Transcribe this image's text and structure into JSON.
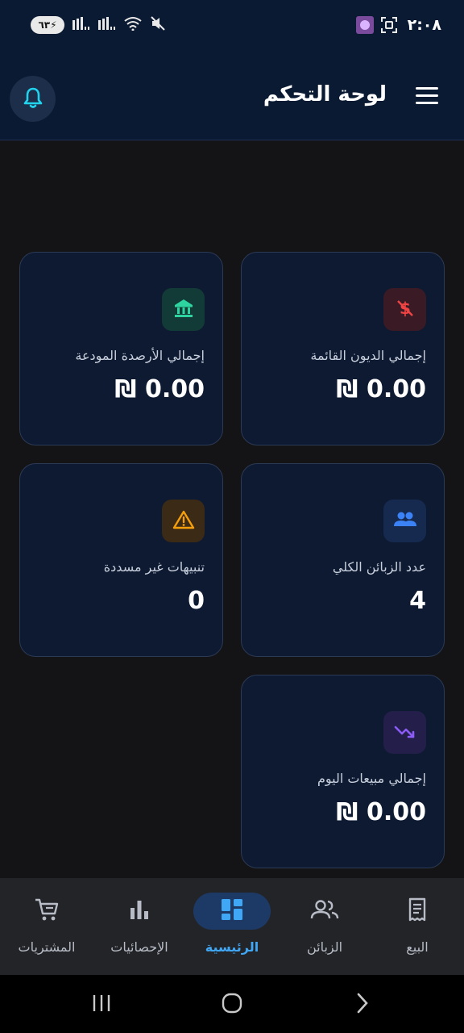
{
  "status_bar": {
    "time": "٢:٠٨",
    "battery": "٦٣"
  },
  "header": {
    "title": "لوحة التحكم"
  },
  "cards": [
    {
      "label": "إجمالي الديون القائمة",
      "value": "0.00 ₪",
      "icon": "dollar-off-icon",
      "color": "#ef4444"
    },
    {
      "label": "إجمالي الأرصدة المودعة",
      "value": "0.00 ₪",
      "icon": "bank-icon",
      "color": "#2dd4a0"
    },
    {
      "label": "عدد الزبائن الكلي",
      "value": "4",
      "icon": "people-icon",
      "color": "#3b82f6"
    },
    {
      "label": "تنبيهات غير مسددة",
      "value": "0",
      "icon": "warning-icon",
      "color": "#f59e0b"
    },
    {
      "label": "إجمالي مبيعات اليوم",
      "value": "0.00 ₪",
      "icon": "trending-down-icon",
      "color": "#8b5cf6"
    }
  ],
  "bottom_nav": {
    "items": [
      {
        "label": "البيع",
        "icon": "receipt-icon",
        "active": false
      },
      {
        "label": "الزبائن",
        "icon": "people-outline-icon",
        "active": false
      },
      {
        "label": "الرئيسية",
        "icon": "dashboard-icon",
        "active": true
      },
      {
        "label": "الإحصائيات",
        "icon": "bar-chart-icon",
        "active": false
      },
      {
        "label": "المشتريات",
        "icon": "cart-icon",
        "active": false
      }
    ]
  },
  "colors": {
    "appbar_bg": "#0b1a33",
    "page_bg": "#141416",
    "card_bg": "#0e1a31",
    "accent": "#3fa7f5",
    "bell": "#22d3ee"
  }
}
